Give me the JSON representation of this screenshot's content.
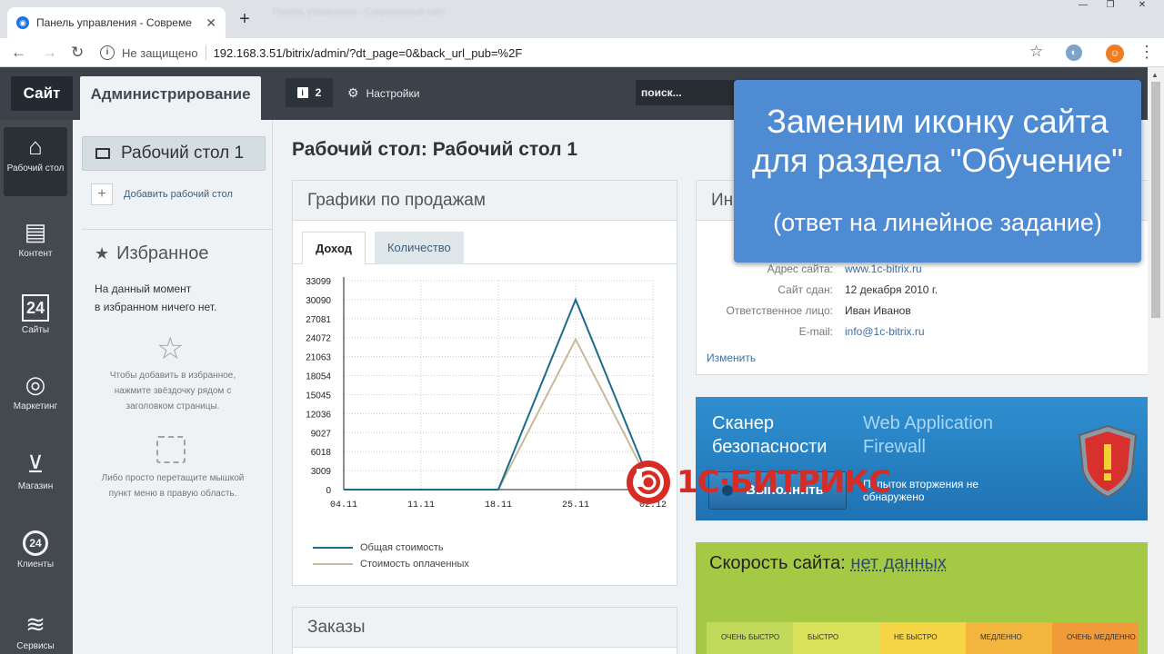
{
  "browser": {
    "tab_title": "Панель управления - Совреме",
    "bg_tab_text": "Панель управления - Современный сайт",
    "not_secure": "Не защищено",
    "url": "192.168.3.51/bitrix/admin/?dt_page=0&back_url_pub=%2F"
  },
  "top": {
    "site": "Сайт",
    "admin": "Администрирование",
    "notif_count": "2",
    "settings": "Настройки",
    "search_placeholder": "поиск..."
  },
  "leftmenu": [
    {
      "label": "Рабочий стол",
      "icon": "home-icon"
    },
    {
      "label": "Контент",
      "icon": "document-icon"
    },
    {
      "label": "Сайты",
      "icon": "calendar-24-icon"
    },
    {
      "label": "Маркетинг",
      "icon": "target-icon"
    },
    {
      "label": "Магазин",
      "icon": "basket-icon"
    },
    {
      "label": "Клиенты",
      "icon": "clients-24-icon"
    },
    {
      "label": "Сервисы",
      "icon": "layers-icon"
    }
  ],
  "panel2": {
    "desktop": "Рабочий стол 1",
    "add_desktop": "Добавить рабочий стол",
    "favorites": "Избранное",
    "fav_empty_1": "На данный момент",
    "fav_empty_2": "в избранном ничего нет.",
    "hint1": "Чтобы добавить в избранное, нажмите звёздочку рядом с заголовком страницы.",
    "hint2": "Либо просто перетащите мышкой пункт меню в правую область."
  },
  "main": {
    "title": "Рабочий стол: Рабочий стол 1",
    "sales_title": "Графики по продажам",
    "tab_income": "Доход",
    "tab_qty": "Количество",
    "orders_title": "Заказы",
    "info_title": "Ин",
    "info": [
      {
        "k": "Адрес сайта:",
        "v": "www.1c-bitrix.ru"
      },
      {
        "k": "Сайт сдан:",
        "v": "12 декабря 2010 г."
      },
      {
        "k": "Ответственное лицо:",
        "v": "Иван Иванов"
      },
      {
        "k": "E-mail:",
        "v": "info@1c-bitrix.ru"
      }
    ],
    "change": "Изменить",
    "scanner_1": "Сканер",
    "scanner_2": "безопасности",
    "waf_1": "Web Application",
    "waf_2": "Firewall",
    "run": "Выполнить",
    "scan_note": "Попыток вторжения не обнаружено",
    "speed_label": "Скорость сайта:",
    "speed_value": "нет данных",
    "scale": [
      {
        "label": "ОЧЕНЬ БЫСТРО",
        "color": "#c3d95b"
      },
      {
        "label": "БЫСТРО",
        "color": "#d9e05a"
      },
      {
        "label": "НЕ БЫСТРО",
        "color": "#f5d445"
      },
      {
        "label": "МЕДЛЕННО",
        "color": "#f4b53e"
      },
      {
        "label": "ОЧЕНЬ МЕДЛЕННО",
        "color": "#f19a3a"
      }
    ],
    "logo": "1С·БИТРИКС"
  },
  "overlay": {
    "line1": "Заменим иконку сайта",
    "line2": "для раздела \"Обучение\"",
    "sub": "(ответ на линейное задание)"
  },
  "chart_data": {
    "type": "line",
    "x": [
      "04.11",
      "11.11",
      "18.11",
      "25.11",
      "02.12"
    ],
    "y_ticks": [
      0,
      3009,
      6018,
      9027,
      12036,
      15045,
      18054,
      21063,
      24072,
      27081,
      30090,
      33099
    ],
    "ylim": [
      0,
      33099
    ],
    "series": [
      {
        "name": "Общая стоимость",
        "color": "#1b6b8c",
        "points": [
          [
            0,
            0
          ],
          [
            1,
            0
          ],
          [
            2,
            0
          ],
          [
            3,
            30090
          ],
          [
            4,
            0
          ]
        ]
      },
      {
        "name": "Стоимость оплаченных",
        "color": "#c9b99a",
        "points": [
          [
            0,
            0
          ],
          [
            1,
            0
          ],
          [
            2,
            0
          ],
          [
            3,
            23800
          ],
          [
            4,
            0
          ]
        ]
      }
    ]
  }
}
